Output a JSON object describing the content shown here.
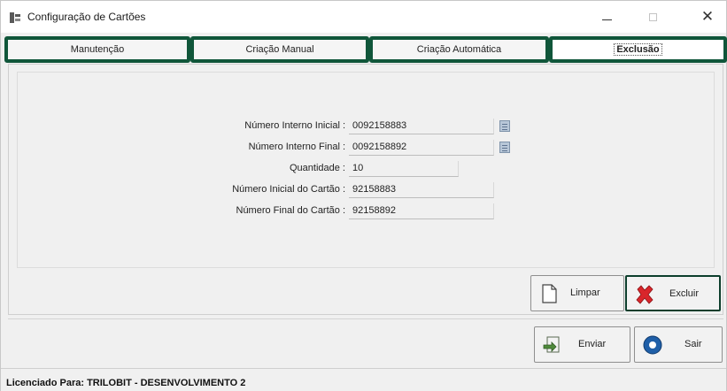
{
  "window": {
    "title": "Configuração de Cartões",
    "controls": {
      "minimize": "—",
      "maximize": "☐",
      "close": "✕"
    }
  },
  "tabs": [
    {
      "label": "Manutenção",
      "active": false
    },
    {
      "label": "Criação Manual",
      "active": false
    },
    {
      "label": "Criação Automática",
      "active": false
    },
    {
      "label": "Exclusão",
      "active": true
    }
  ],
  "form": {
    "numero_interno_inicial": {
      "label": "Número Interno Inicial :",
      "value": "0092158883"
    },
    "numero_interno_final": {
      "label": "Número Interno Final :",
      "value": "0092158892"
    },
    "quantidade": {
      "label": "Quantidade :",
      "value": "10"
    },
    "numero_inicial_cartao": {
      "label": "Número Inicial do Cartão :",
      "value": "92158883"
    },
    "numero_final_cartao": {
      "label": "Número Final do Cartão :",
      "value": "92158892"
    }
  },
  "actions": {
    "limpar": "Limpar",
    "excluir": "Excluir",
    "enviar": "Enviar",
    "sair": "Sair"
  },
  "icons": {
    "lookup": "document-lookup-icon",
    "limpar": "blank-page-icon",
    "excluir": "red-x-icon",
    "enviar": "send-document-icon",
    "sair": "exit-globe-icon"
  },
  "colors": {
    "tab_border": "#10563a",
    "excluir_icon": "#d9262b",
    "sair_icon": "#1f5fa8"
  },
  "status": {
    "text": "Licenciado Para: TRILOBIT - DESENVOLVIMENTO 2"
  }
}
